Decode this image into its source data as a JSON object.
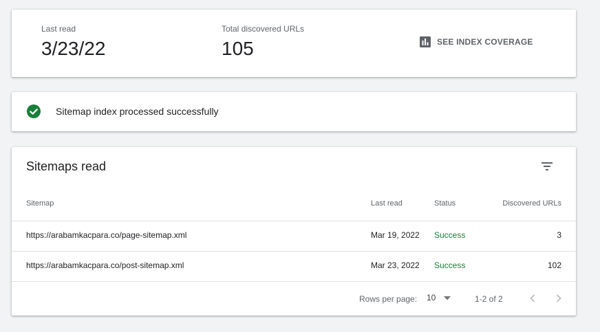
{
  "summary": {
    "last_read_label": "Last read",
    "last_read_value": "3/23/22",
    "total_label": "Total discovered URLs",
    "total_value": "105",
    "coverage_button": "SEE INDEX COVERAGE",
    "coverage_icon": "bar-chart-icon"
  },
  "status": {
    "icon": "check-circle-icon",
    "message": "Sitemap index processed successfully",
    "color": "#188038"
  },
  "table": {
    "title": "Sitemaps read",
    "filter_icon": "filter-icon",
    "columns": [
      "Sitemap",
      "Last read",
      "Status",
      "Discovered URLs"
    ],
    "rows": [
      {
        "sitemap": "https://arabamkacpara.co/page-sitemap.xml",
        "last_read": "Mar 19, 2022",
        "status": "Success",
        "urls": "3"
      },
      {
        "sitemap": "https://arabamkacpara.co/post-sitemap.xml",
        "last_read": "Mar 23, 2022",
        "status": "Success",
        "urls": "102"
      }
    ],
    "pagination": {
      "rows_per_page_label": "Rows per page:",
      "rows_per_page_value": "10",
      "range": "1-2 of 2"
    }
  },
  "colors": {
    "success": "#188038",
    "muted": "#5f6368",
    "background": "#f1f3f4"
  }
}
